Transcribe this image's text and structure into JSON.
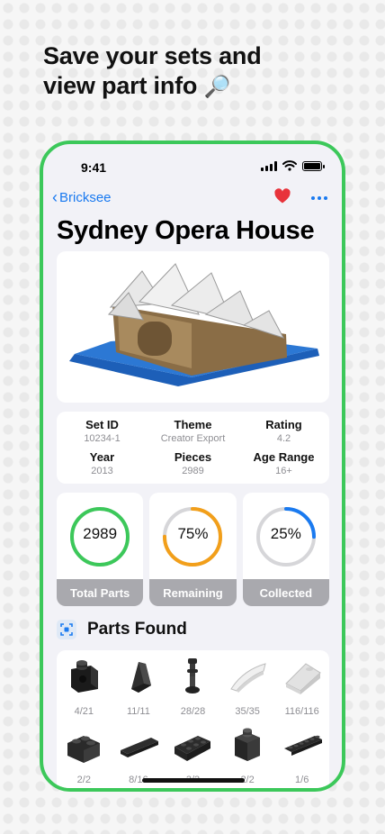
{
  "headline": {
    "line1": "Save your sets and",
    "line2": "view part info",
    "emoji": "🔎"
  },
  "status": {
    "time": "9:41"
  },
  "nav": {
    "back_label": "Bricksee",
    "favorite_icon": "heart-icon",
    "more_icon": "ellipsis-icon"
  },
  "set": {
    "title": "Sydney Opera House",
    "info": [
      {
        "label": "Set ID",
        "value": "10234-1"
      },
      {
        "label": "Theme",
        "value": "Creator Export"
      },
      {
        "label": "Rating",
        "value": "4.2"
      },
      {
        "label": "Year",
        "value": "2013"
      },
      {
        "label": "Pieces",
        "value": "2989"
      },
      {
        "label": "Age Range",
        "value": "16+"
      }
    ]
  },
  "stats": [
    {
      "value": "2989",
      "label": "Total Parts",
      "progress": 1.0,
      "color": "#3cc85a"
    },
    {
      "value": "75%",
      "label": "Remaining",
      "progress": 0.75,
      "color": "#f29f1a"
    },
    {
      "value": "25%",
      "label": "Collected",
      "progress": 0.25,
      "color": "#1a7af0"
    }
  ],
  "parts": {
    "title": "Parts Found",
    "items": [
      {
        "count": "4/21",
        "icon": "brick-stud-icon"
      },
      {
        "count": "11/11",
        "icon": "slope-icon"
      },
      {
        "count": "28/28",
        "icon": "lamp-post-icon"
      },
      {
        "count": "35/35",
        "icon": "curved-wedge-icon"
      },
      {
        "count": "116/116",
        "icon": "light-slope-icon"
      },
      {
        "count": "2/2",
        "icon": "corner-brick-icon"
      },
      {
        "count": "8/16",
        "icon": "flat-tile-icon"
      },
      {
        "count": "3/3",
        "icon": "plate-icon"
      },
      {
        "count": "2/2",
        "icon": "cube-brick-icon"
      },
      {
        "count": "1/6",
        "icon": "long-plate-icon"
      }
    ]
  },
  "colors": {
    "accent": "#1a7af0",
    "frame": "#3cc85a",
    "heart": "#e8333b"
  }
}
